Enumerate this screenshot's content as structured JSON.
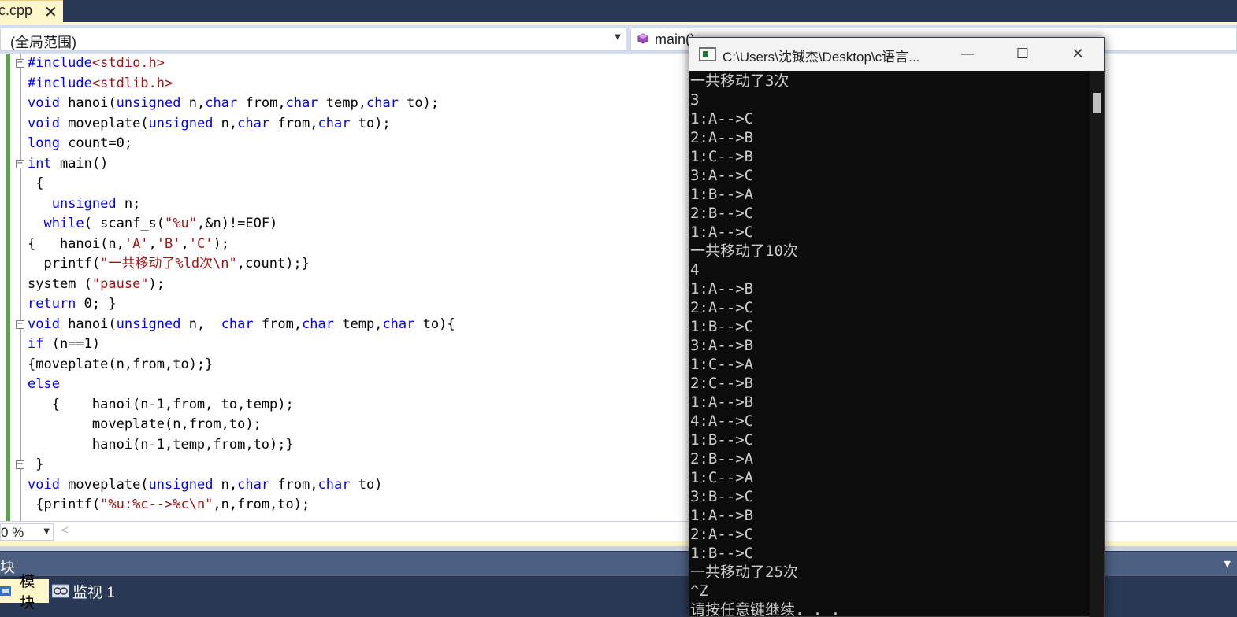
{
  "tab": {
    "label": "c.cpp",
    "close_glyph": "✕"
  },
  "navbar": {
    "scope": "(全局范围)",
    "member": "main()"
  },
  "code_lines": [
    [
      {
        "t": "#include",
        "c": "pp"
      },
      {
        "t": "<stdio.h>",
        "c": "inc"
      }
    ],
    [
      {
        "t": "#include",
        "c": "pp"
      },
      {
        "t": "<stdlib.h>",
        "c": "inc"
      }
    ],
    [
      {
        "t": "void",
        "c": "kw"
      },
      {
        "t": " hanoi(",
        "c": ""
      },
      {
        "t": "unsigned",
        "c": "kw"
      },
      {
        "t": " n,",
        "c": ""
      },
      {
        "t": "char",
        "c": "kw"
      },
      {
        "t": " from,",
        "c": ""
      },
      {
        "t": "char",
        "c": "kw"
      },
      {
        "t": " temp,",
        "c": ""
      },
      {
        "t": "char",
        "c": "kw"
      },
      {
        "t": " to);",
        "c": ""
      }
    ],
    [
      {
        "t": "void",
        "c": "kw"
      },
      {
        "t": " moveplate(",
        "c": ""
      },
      {
        "t": "unsigned",
        "c": "kw"
      },
      {
        "t": " n,",
        "c": ""
      },
      {
        "t": "char",
        "c": "kw"
      },
      {
        "t": " from,",
        "c": ""
      },
      {
        "t": "char",
        "c": "kw"
      },
      {
        "t": " to);",
        "c": ""
      }
    ],
    [
      {
        "t": "long",
        "c": "kw"
      },
      {
        "t": " count=0;",
        "c": ""
      }
    ],
    [
      {
        "t": "int",
        "c": "kw"
      },
      {
        "t": " main()",
        "c": ""
      }
    ],
    [
      {
        "t": " {",
        "c": ""
      }
    ],
    [
      {
        "t": "   ",
        "c": ""
      },
      {
        "t": "unsigned",
        "c": "kw"
      },
      {
        "t": " n;",
        "c": ""
      }
    ],
    [
      {
        "t": "  ",
        "c": ""
      },
      {
        "t": "while",
        "c": "kw"
      },
      {
        "t": "( scanf_s(",
        "c": ""
      },
      {
        "t": "\"%u\"",
        "c": "str"
      },
      {
        "t": ",&n)!=EOF)",
        "c": ""
      }
    ],
    [
      {
        "t": "{   hanoi(n,",
        "c": ""
      },
      {
        "t": "'A'",
        "c": "str"
      },
      {
        "t": ",",
        "c": ""
      },
      {
        "t": "'B'",
        "c": "str"
      },
      {
        "t": ",",
        "c": ""
      },
      {
        "t": "'C'",
        "c": "str"
      },
      {
        "t": ");",
        "c": ""
      }
    ],
    [
      {
        "t": "  printf(",
        "c": ""
      },
      {
        "t": "\"一共移动了%ld次\\n\"",
        "c": "str"
      },
      {
        "t": ",count);}",
        "c": ""
      }
    ],
    [
      {
        "t": "system (",
        "c": ""
      },
      {
        "t": "\"pause\"",
        "c": "str"
      },
      {
        "t": ");",
        "c": ""
      }
    ],
    [
      {
        "t": "return",
        "c": "kw"
      },
      {
        "t": " 0; }",
        "c": ""
      }
    ],
    [
      {
        "t": "void",
        "c": "kw"
      },
      {
        "t": " hanoi(",
        "c": ""
      },
      {
        "t": "unsigned",
        "c": "kw"
      },
      {
        "t": " n,  ",
        "c": ""
      },
      {
        "t": "char",
        "c": "kw"
      },
      {
        "t": " from,",
        "c": ""
      },
      {
        "t": "char",
        "c": "kw"
      },
      {
        "t": " temp,",
        "c": ""
      },
      {
        "t": "char",
        "c": "kw"
      },
      {
        "t": " to){",
        "c": ""
      }
    ],
    [
      {
        "t": "if",
        "c": "kw"
      },
      {
        "t": " (n==1)",
        "c": ""
      }
    ],
    [
      {
        "t": "{moveplate(n,from,to);}",
        "c": ""
      }
    ],
    [
      {
        "t": "else",
        "c": "kw"
      }
    ],
    [
      {
        "t": "   {    hanoi(n-1,from, to,temp);",
        "c": ""
      }
    ],
    [
      {
        "t": "        moveplate(n,from,to);",
        "c": ""
      }
    ],
    [
      {
        "t": "        hanoi(n-1,temp,from,to);}",
        "c": ""
      }
    ],
    [
      {
        "t": " }",
        "c": ""
      }
    ],
    [
      {
        "t": "void",
        "c": "kw"
      },
      {
        "t": " moveplate(",
        "c": ""
      },
      {
        "t": "unsigned",
        "c": "kw"
      },
      {
        "t": " n,",
        "c": ""
      },
      {
        "t": "char",
        "c": "kw"
      },
      {
        "t": " from,",
        "c": ""
      },
      {
        "t": "char",
        "c": "kw"
      },
      {
        "t": " to)",
        "c": ""
      }
    ],
    [
      {
        "t": " {printf(",
        "c": ""
      },
      {
        "t": "\"%u:%c-->%c\\n\"",
        "c": "str"
      },
      {
        "t": ",n,from,to);",
        "c": ""
      }
    ]
  ],
  "collapse_marks": [
    "⊟",
    "⊟",
    "⊟",
    "⊟"
  ],
  "editor_status": {
    "zoom": "0 %",
    "hscroll_glyph": "<"
  },
  "tool_window": {
    "title": "块",
    "tabs": [
      {
        "label": "模块"
      },
      {
        "label": "监视 1"
      }
    ]
  },
  "console": {
    "title": "C:\\Users\\沈铖杰\\Desktop\\c语言...",
    "min_glyph": "—",
    "max_glyph": "☐",
    "close_glyph": "✕",
    "lines": [
      "一共移动了3次",
      "3",
      "1:A-->C",
      "2:A-->B",
      "1:C-->B",
      "3:A-->C",
      "1:B-->A",
      "2:B-->C",
      "1:A-->C",
      "一共移动了10次",
      "4",
      "1:A-->B",
      "2:A-->C",
      "1:B-->C",
      "3:A-->B",
      "1:C-->A",
      "2:C-->B",
      "1:A-->B",
      "4:A-->C",
      "1:B-->C",
      "2:B-->A",
      "1:C-->A",
      "3:B-->C",
      "1:A-->B",
      "2:A-->C",
      "1:B-->C",
      "一共移动了25次",
      "^Z",
      "请按任意键继续. . ."
    ]
  },
  "colors": {
    "keyword": "#0000ff",
    "string": "#a31515",
    "change_bar": "#57a64a",
    "ide_frame": "#293955",
    "tab_active": "#fff6cc"
  }
}
